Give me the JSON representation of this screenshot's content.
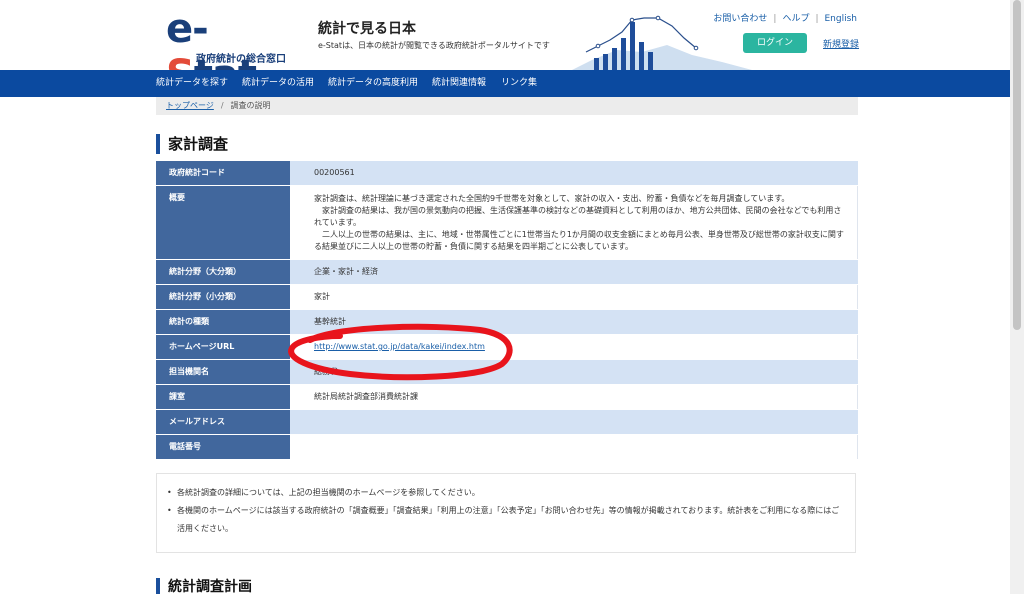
{
  "header": {
    "logo_main_e": "e-",
    "logo_main_s": "S",
    "logo_main_rest": "tat",
    "logo_sub": "政府統計の総合窓口",
    "site_title": "統計で見る日本",
    "site_desc": "e-Statは、日本の統計が閲覧できる政府統計ポータルサイトです",
    "util_links": [
      "お問い合わせ",
      "ヘルプ",
      "English"
    ],
    "login_label": "ログイン",
    "register_label": "新規登録"
  },
  "nav": {
    "items": [
      "統計データを探す",
      "統計データの活用",
      "統計データの高度利用",
      "統計関連情報",
      "リンク集"
    ]
  },
  "breadcrumb": {
    "home": "トップページ",
    "current": "調査の説明"
  },
  "page_title": "家計調査",
  "table": {
    "code_label": "政府統計コード",
    "code_value": "00200561",
    "summary_label": "概要",
    "summary_lines": [
      "家計調査は、統計理論に基づき選定された全国約9千世帯を対象として、家計の収入・支出、貯蓄・負債などを毎月調査しています。",
      "　家計調査の結果は、我が国の景気動向の把握、生活保護基準の検討などの基礎資料として利用のほか、地方公共団体、民間の会社などでも利用されています。",
      "　二人以上の世帯の結果は、主に、地域・世帯属性ごとに1世帯当たり1か月間の収支金額にまとめ毎月公表、単身世帯及び総世帯の家計収支に関する結果並びに二人以上の世帯の貯蓄・負債に関する結果を四半期ごとに公表しています。"
    ],
    "field_major_label": "統計分野（大分類）",
    "field_major_value": "企業・家計・経済",
    "field_minor_label": "統計分野（小分類）",
    "field_minor_value": "家計",
    "type_label": "統計の種類",
    "type_value": "基幹統計",
    "homepage_label": "ホームページURL",
    "homepage_value": "http://www.stat.go.jp/data/kakei/index.htm",
    "agency_label": "担当機関名",
    "agency_value": "総務省",
    "section_label": "課室",
    "section_value": "統計局統計調査部消費統計課",
    "email_label": "メールアドレス",
    "email_value": "",
    "phone_label": "電話番号",
    "phone_value": ""
  },
  "notes": [
    "各統計調査の詳細については、上記の担当機関のホームページを参照してください。",
    "各機関のホームページには該当する政府統計の「調査概要」「調査結果」「利用上の注意」「公表予定」「お問い合わせ先」等の情報が掲載されております。統計表をご利用になる際にはご活用ください。"
  ],
  "section_heading": "統計調査計画",
  "colors": {
    "nav_bg": "#0b4aa0",
    "header_cell_bg": "#41679d",
    "row_blue_bg": "#d4e2f4",
    "login_bg": "#2bb5a0",
    "annotation": "#e8141c"
  }
}
